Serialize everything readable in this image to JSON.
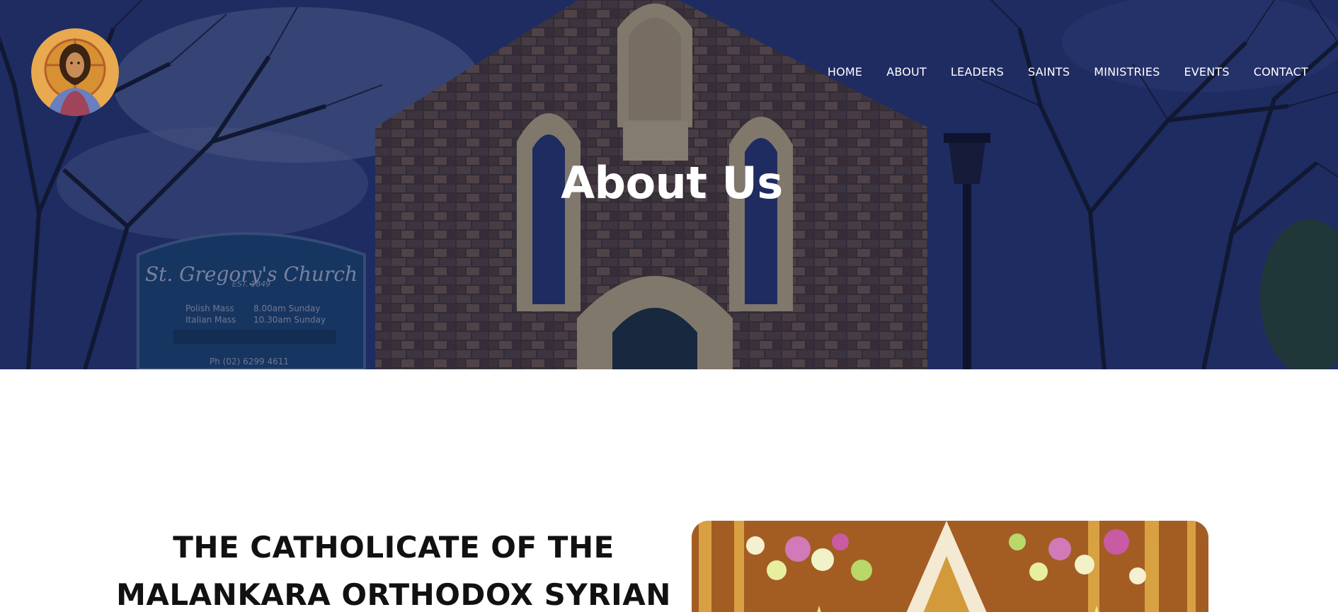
{
  "header": {
    "logo_alt": "Christ Pantocrator icon",
    "nav": [
      {
        "label": "HOME"
      },
      {
        "label": "ABOUT"
      },
      {
        "label": "LEADERS"
      },
      {
        "label": "SAINTS"
      },
      {
        "label": "MINISTRIES"
      },
      {
        "label": "EVENTS"
      },
      {
        "label": "CONTACT"
      }
    ]
  },
  "hero": {
    "title": "About Us",
    "sign": {
      "name": "St. Gregory's Church",
      "est": "EST. 1849",
      "row1_label": "Polish Mass",
      "row1_time": "8.00am Sunday",
      "row2_label": "Italian Mass",
      "row2_time": "10.30am Sunday",
      "phone": "Ph (02) 6299 4611"
    }
  },
  "main": {
    "heading_line1": "THE CATHOLICATE OF THE",
    "heading_line2": "MALANKARA ORTHODOX SYRIAN"
  },
  "colors": {
    "hero_overlay": "#1e2758",
    "text_dark": "#111111",
    "nav_text": "#ffffff"
  }
}
